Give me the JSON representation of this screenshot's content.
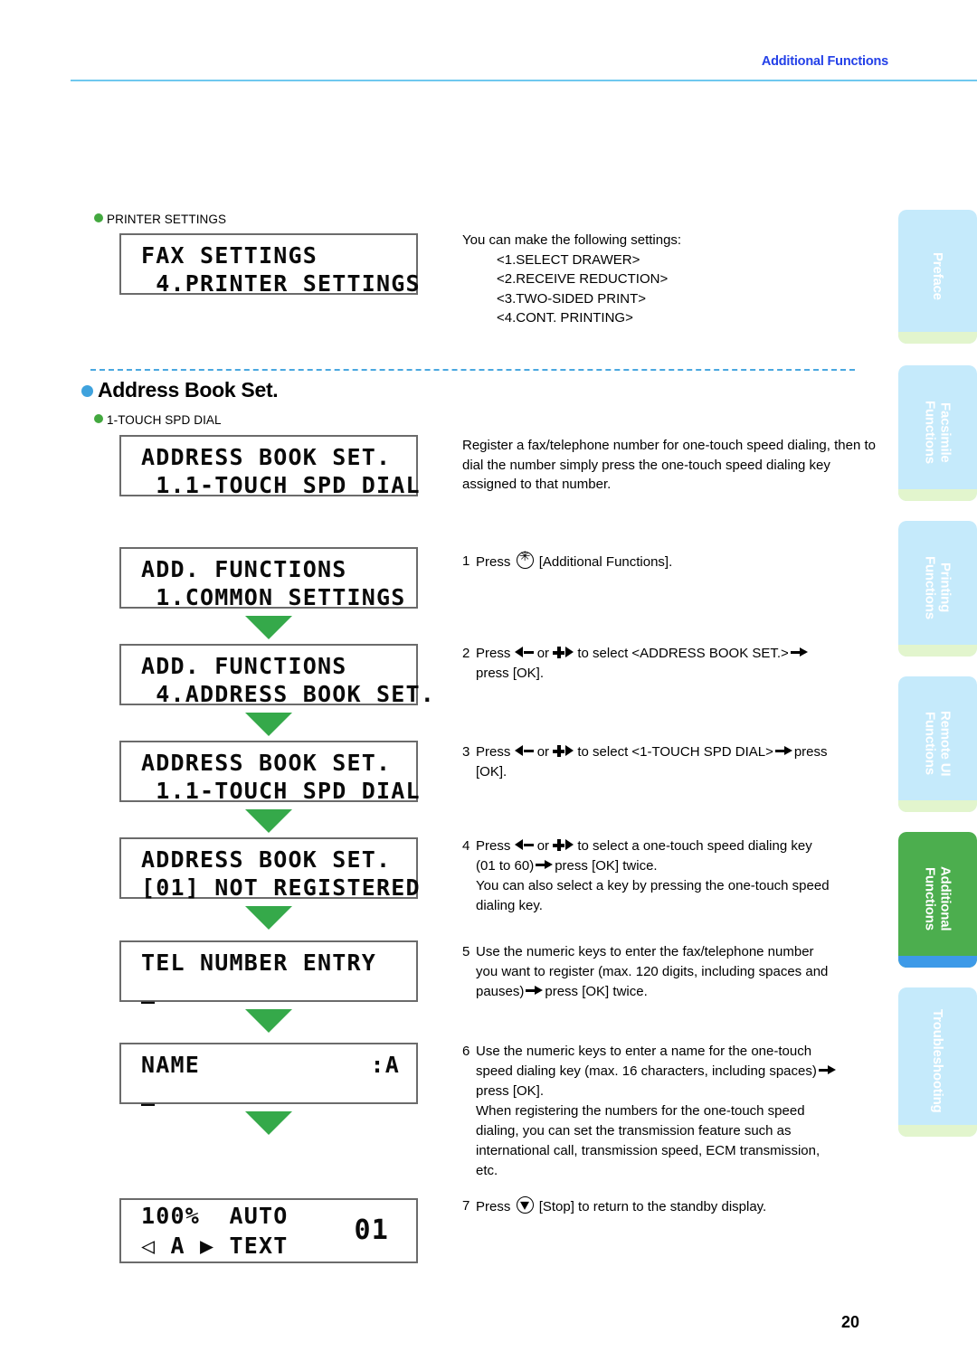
{
  "header": {
    "title": "Additional Functions"
  },
  "page_number": "20",
  "sections": {
    "printer_settings": {
      "label": "PRINTER SETTINGS",
      "lcd": {
        "line1": "FAX SETTINGS",
        "line2": " 4.PRINTER SETTINGS"
      },
      "intro": "You can make the following settings:",
      "items": [
        "<1.SELECT DRAWER>",
        "<2.RECEIVE REDUCTION>",
        "<3.TWO-SIDED PRINT>",
        "<4.CONT. PRINTING>"
      ]
    },
    "address_book": {
      "heading": "Address Book Set.",
      "sub_label": "1-TOUCH SPD DIAL",
      "lcd": {
        "line1": "ADDRESS BOOK SET.",
        "line2": " 1.1-TOUCH SPD DIAL"
      },
      "description": "Register a fax/telephone number for one-touch speed dialing, then to dial the number simply press the one-touch speed dialing key assigned to that number."
    }
  },
  "flow_screens": [
    {
      "line1": "ADD. FUNCTIONS",
      "line2": " 1.COMMON SETTINGS"
    },
    {
      "line1": "ADD. FUNCTIONS",
      "line2": " 4.ADDRESS BOOK SET."
    },
    {
      "line1": "ADDRESS BOOK SET.",
      "line2": " 1.1-TOUCH SPD DIAL"
    },
    {
      "line1": "ADDRESS BOOK SET.",
      "line2": "[01] NOT REGISTERED"
    },
    {
      "line1": "TEL NUMBER ENTRY",
      "line2": "_"
    },
    {
      "line1": "NAME",
      "line1_right": ":A",
      "line2": "_"
    }
  ],
  "standby_screen": {
    "line1": "100%  AUTO",
    "line2": "◁ A ▶ TEXT",
    "key_number": "01"
  },
  "steps": {
    "s1": {
      "num": "1",
      "a": "Press",
      "icon": "additional-functions-key",
      "b": "[Additional Functions]."
    },
    "s2": {
      "num": "2",
      "a": "Press",
      "b": "or",
      "c": "to select <ADDRESS BOOK SET.>",
      "d": "press [OK]."
    },
    "s3": {
      "num": "3",
      "a": "Press",
      "b": "or",
      "c": "to select <1-TOUCH SPD DIAL>",
      "d": "press",
      "e": "[OK]."
    },
    "s4": {
      "num": "4",
      "a": "Press",
      "b": "or",
      "c": "to select a one-touch speed dialing key",
      "d": "(01 to 60)",
      "e": "press [OK] twice.",
      "f": "You can also select a key by pressing the one-touch speed",
      "g": "dialing key."
    },
    "s5": {
      "num": "5",
      "a": "Use the numeric keys to enter the fax/telephone number",
      "b": "you want to register (max. 120 digits, including spaces and",
      "c": "pauses)",
      "d": "press [OK] twice."
    },
    "s6": {
      "num": "6",
      "a": "Use the numeric keys to enter a name for the one-touch",
      "b": "speed dialing key (max. 16 characters, including spaces)",
      "c": "press [OK].",
      "d": "When registering the numbers for the one-touch  speed",
      "e": "dialing, you can set the transmission feature such as",
      "f": "international call, transmission speed, ECM transmission,",
      "g": "etc."
    },
    "s7": {
      "num": "7",
      "a": "Press",
      "icon": "stop-key",
      "b": "[Stop] to return to the standby display."
    }
  },
  "sidebar": {
    "tabs": [
      {
        "label": "Preface",
        "active": false
      },
      {
        "label": "Facsimile\nFunctions",
        "active": false
      },
      {
        "label": "Printing\nFunctions",
        "active": false
      },
      {
        "label": "Remote UI\nFunctions",
        "active": false
      },
      {
        "label": "Additional\nFunctions",
        "active": true
      },
      {
        "label": "Troubleshooting",
        "active": false
      }
    ]
  },
  "colors": {
    "header_blue": "#2340e8",
    "rule_blue": "#6fc8ef",
    "dashed_blue": "#4aa8e0",
    "bullet_green": "#43a83f",
    "bullet_blue": "#3fa2dd",
    "arrow_green": "#35a94a",
    "tab_inactive": "#c5eafb",
    "tab_foot_green": "#e2f5cd",
    "tab_active": "#4cae4e",
    "tab_active_foot": "#3d9ae8"
  }
}
